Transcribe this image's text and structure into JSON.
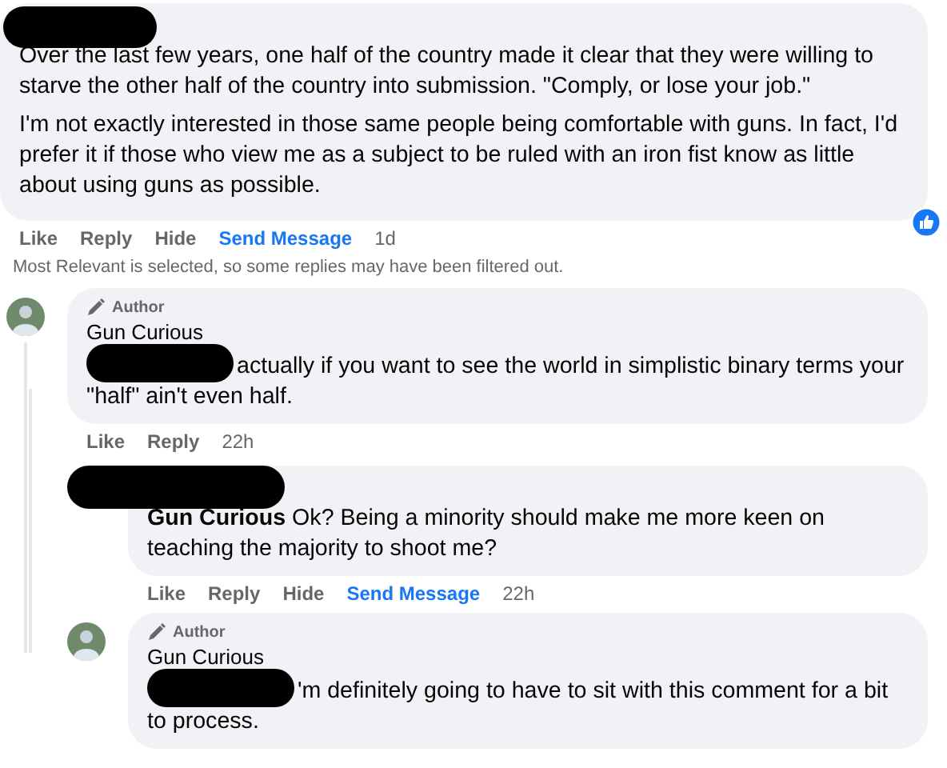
{
  "comments": [
    {
      "redacted_name": true,
      "avatar": false,
      "paragraphs": [
        "Over the last few years, one half of the country made it clear that they were willing to starve the other half of the country into submission. \"Comply, or lose your job.\"",
        "I'm not exactly interested in those same people being comfortable with guns. In fact, I'd prefer it if those who view me as a subject to be ruled with an iron fist know as little about using guns as possible."
      ],
      "liked": true,
      "actions": [
        {
          "label": "Like",
          "kind": "plain"
        },
        {
          "label": "Reply",
          "kind": "plain"
        },
        {
          "label": "Hide",
          "kind": "plain"
        },
        {
          "label": "Send Message",
          "kind": "link"
        }
      ],
      "time": "1d",
      "notice": "Most Relevant is selected, so some replies may have been filtered out.",
      "children": [
        {
          "redacted_name": false,
          "avatar": true,
          "badge": "Author",
          "name": "Gun Curious",
          "redacted_mention": true,
          "paragraphs": [
            "actually if you want to see the world in simplistic binary terms your \"half\" ain't even half."
          ],
          "liked": false,
          "actions": [
            {
              "label": "Like",
              "kind": "plain"
            },
            {
              "label": "Reply",
              "kind": "plain"
            }
          ],
          "time": "22h",
          "children": [
            {
              "redacted_name": true,
              "avatar": false,
              "paragraphs": [
                "**Gun Curious** Ok? Being a minority should make me more keen on teaching the majority to shoot me?"
              ],
              "liked": false,
              "actions": [
                {
                  "label": "Like",
                  "kind": "plain"
                },
                {
                  "label": "Reply",
                  "kind": "plain"
                },
                {
                  "label": "Hide",
                  "kind": "plain"
                },
                {
                  "label": "Send Message",
                  "kind": "link"
                }
              ],
              "time": "22h"
            },
            {
              "redacted_name": false,
              "avatar": true,
              "badge": "Author",
              "name": "Gun Curious",
              "redacted_mention": true,
              "paragraphs": [
                "'m definitely going to have to sit with this comment for a bit to process."
              ],
              "liked": false
            }
          ]
        }
      ]
    }
  ]
}
